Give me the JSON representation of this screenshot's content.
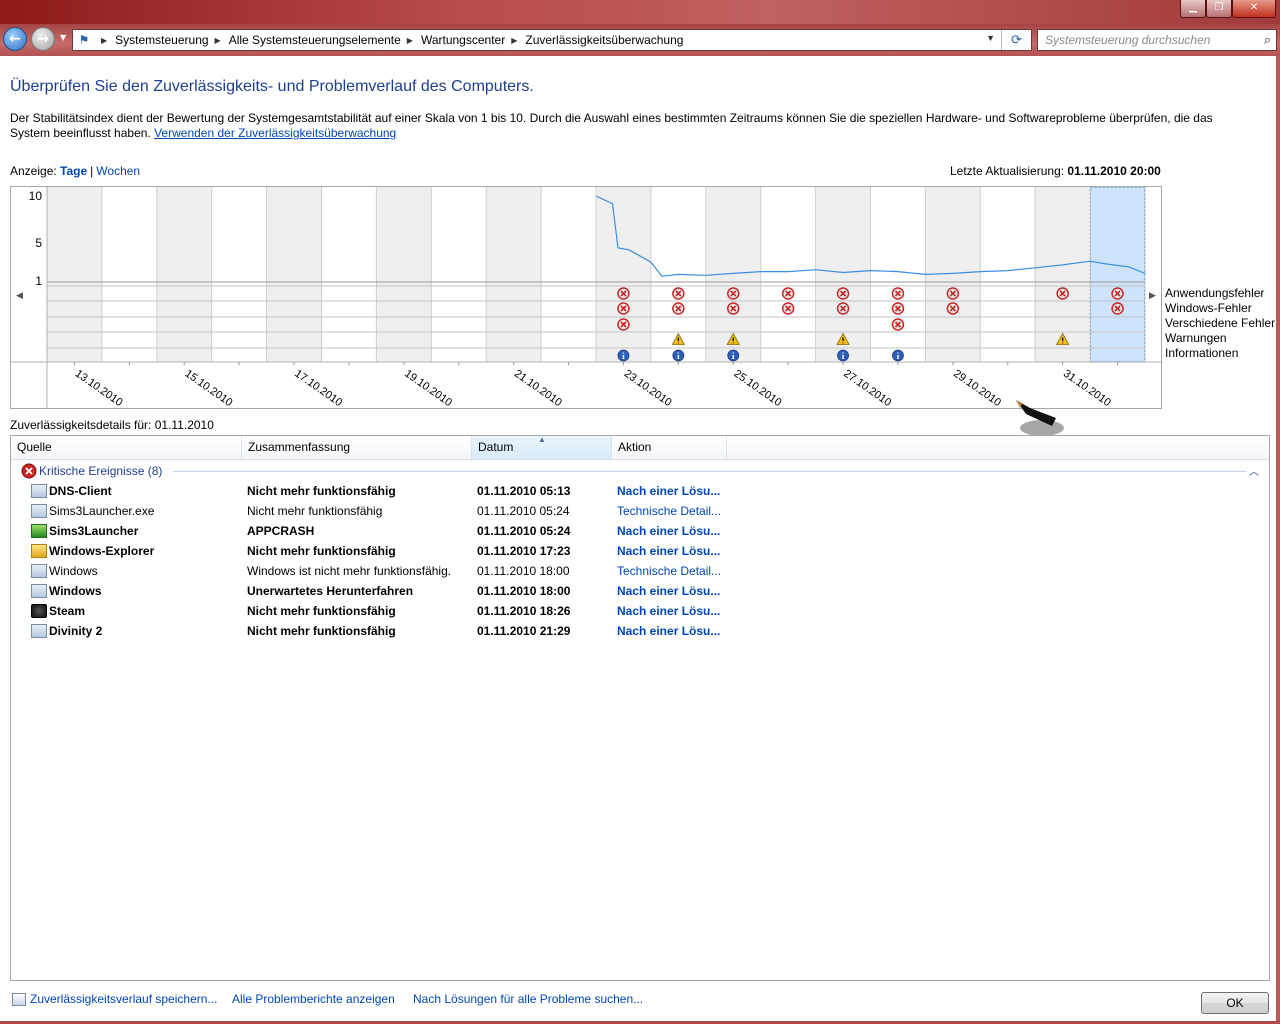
{
  "window": {
    "minimize_icon": "minimize-icon",
    "maximize_icon": "restore-icon",
    "close_icon": "close-icon",
    "close_glyph": "✕",
    "min_glyph": "▁",
    "max_glyph": "❐"
  },
  "nav": {
    "back_glyph": "←",
    "forward_glyph": "→",
    "dropdown_glyph": "▼",
    "refresh_glyph": "⟳",
    "breadcrumbs": [
      "Systemsteuerung",
      "Alle Systemsteuerungselemente",
      "Wartungscenter",
      "Zuverlässigkeitsüberwachung"
    ],
    "search_placeholder": "Systemsteuerung durchsuchen"
  },
  "page": {
    "heading": "Überprüfen Sie den Zuverlässigkeits- und Problemverlauf des Computers.",
    "description": "Der Stabilitätsindex dient der Bewertung der Systemgesamtstabilität auf einer Skala von 1 bis 10. Durch die Auswahl eines bestimmten Zeitraums können Sie die speziellen Hardware- und Softwareprobleme überprüfen, die das System beeinflusst haben.",
    "description_link": "Verwenden der Zuverlässigkeitsüberwachung",
    "view_label": "Anzeige:",
    "view_days": "Tage",
    "view_sep": "|",
    "view_weeks": "Wochen",
    "last_update_label": "Letzte Aktualisierung:",
    "last_update_value": "01.11.2010 20:00"
  },
  "chart_data": {
    "type": "line",
    "title": "",
    "xlabel": "",
    "ylabel": "",
    "ylim": [
      1,
      10
    ],
    "y_ticks": [
      "10",
      "5",
      "1"
    ],
    "x_tick_labels": [
      "13.10.2010",
      "15.10.2010",
      "17.10.2010",
      "19.10.2010",
      "21.10.2010",
      "23.10.2010",
      "25.10.2010",
      "27.10.2010",
      "29.10.2010",
      "31.10.2010"
    ],
    "day_count": 20,
    "selected_day_index": 19,
    "stability_index": {
      "x_day_index": [
        10.0,
        10.3,
        10.4,
        10.6,
        11.0,
        11.2,
        11.5,
        12.0,
        12.5,
        13.0,
        13.5,
        14.0,
        14.5,
        15.0,
        15.5,
        16.0,
        16.5,
        17.0,
        17.5,
        18.0,
        18.5,
        19.0,
        19.3,
        19.7,
        20.0
      ],
      "values": [
        10.0,
        9.2,
        4.5,
        4.3,
        3.0,
        1.5,
        1.7,
        1.6,
        1.8,
        2.0,
        2.0,
        2.2,
        1.9,
        2.1,
        2.0,
        1.7,
        1.8,
        2.0,
        2.1,
        2.4,
        2.7,
        3.1,
        2.8,
        2.5,
        1.8
      ]
    },
    "event_rows": [
      "Anwendungsfehler",
      "Windows-Fehler",
      "Verschiedene Fehler",
      "Warnungen",
      "Informationen"
    ],
    "events": {
      "Anwendungsfehler": [
        10,
        11,
        12,
        13,
        14,
        15,
        16,
        18,
        19
      ],
      "Windows-Fehler": [
        10,
        11,
        12,
        13,
        14,
        15,
        16,
        19
      ],
      "Verschiedene Fehler": [
        10,
        15
      ],
      "Warnungen": [
        11,
        12,
        14,
        18
      ],
      "Informationen": [
        10,
        11,
        12,
        14,
        15
      ]
    }
  },
  "details": {
    "label": "Zuverlässigkeitsdetails für: 01.11.2010",
    "columns": [
      "Quelle",
      "Zusammenfassung",
      "Datum",
      "Aktion"
    ],
    "group_label": "Kritische Ereignisse (8)",
    "rows": [
      {
        "source": "DNS-Client",
        "summary": "Nicht mehr funktionsfähig",
        "date": "01.11.2010 05:13",
        "action": "Nach einer Lösu...",
        "bold": true,
        "icon": "app"
      },
      {
        "source": "Sims3Launcher.exe",
        "summary": "Nicht mehr funktionsfähig",
        "date": "01.11.2010 05:24",
        "action": "Technische Detail...",
        "bold": false,
        "icon": "app"
      },
      {
        "source": "Sims3Launcher",
        "summary": "APPCRASH",
        "date": "01.11.2010 05:24",
        "action": "Nach einer Lösu...",
        "bold": true,
        "icon": "sims"
      },
      {
        "source": "Windows-Explorer",
        "summary": "Nicht mehr funktionsfähig",
        "date": "01.11.2010 17:23",
        "action": "Nach einer Lösu...",
        "bold": true,
        "icon": "explorer"
      },
      {
        "source": "Windows",
        "summary": "Windows ist nicht mehr funktionsfähig.",
        "date": "01.11.2010 18:00",
        "action": "Technische Detail...",
        "bold": false,
        "icon": "app"
      },
      {
        "source": "Windows",
        "summary": "Unerwartetes Herunterfahren",
        "date": "01.11.2010 18:00",
        "action": "Nach einer Lösu...",
        "bold": true,
        "icon": "app"
      },
      {
        "source": "Steam",
        "summary": "Nicht mehr funktionsfähig",
        "date": "01.11.2010 18:26",
        "action": "Nach einer Lösu...",
        "bold": true,
        "icon": "steam"
      },
      {
        "source": "Divinity 2",
        "summary": "Nicht mehr funktionsfähig",
        "date": "01.11.2010 21:29",
        "action": "Nach einer Lösu...",
        "bold": true,
        "icon": "app"
      }
    ]
  },
  "footer": {
    "save_link": "Zuverlässigkeitsverlauf speichern...",
    "reports_link": "Alle Problemberichte anzeigen",
    "solutions_link": "Nach Lösungen für alle Probleme suchen...",
    "ok_label": "OK"
  },
  "colors": {
    "heading": "#1e3e8e",
    "link": "#0046b4",
    "stability_line": "#3b8fe0",
    "selected_day": "#cde4fb",
    "shaded_column": "#efefef",
    "error": "#c8282a",
    "warning": "#f0c020",
    "info": "#2f5fb8"
  }
}
